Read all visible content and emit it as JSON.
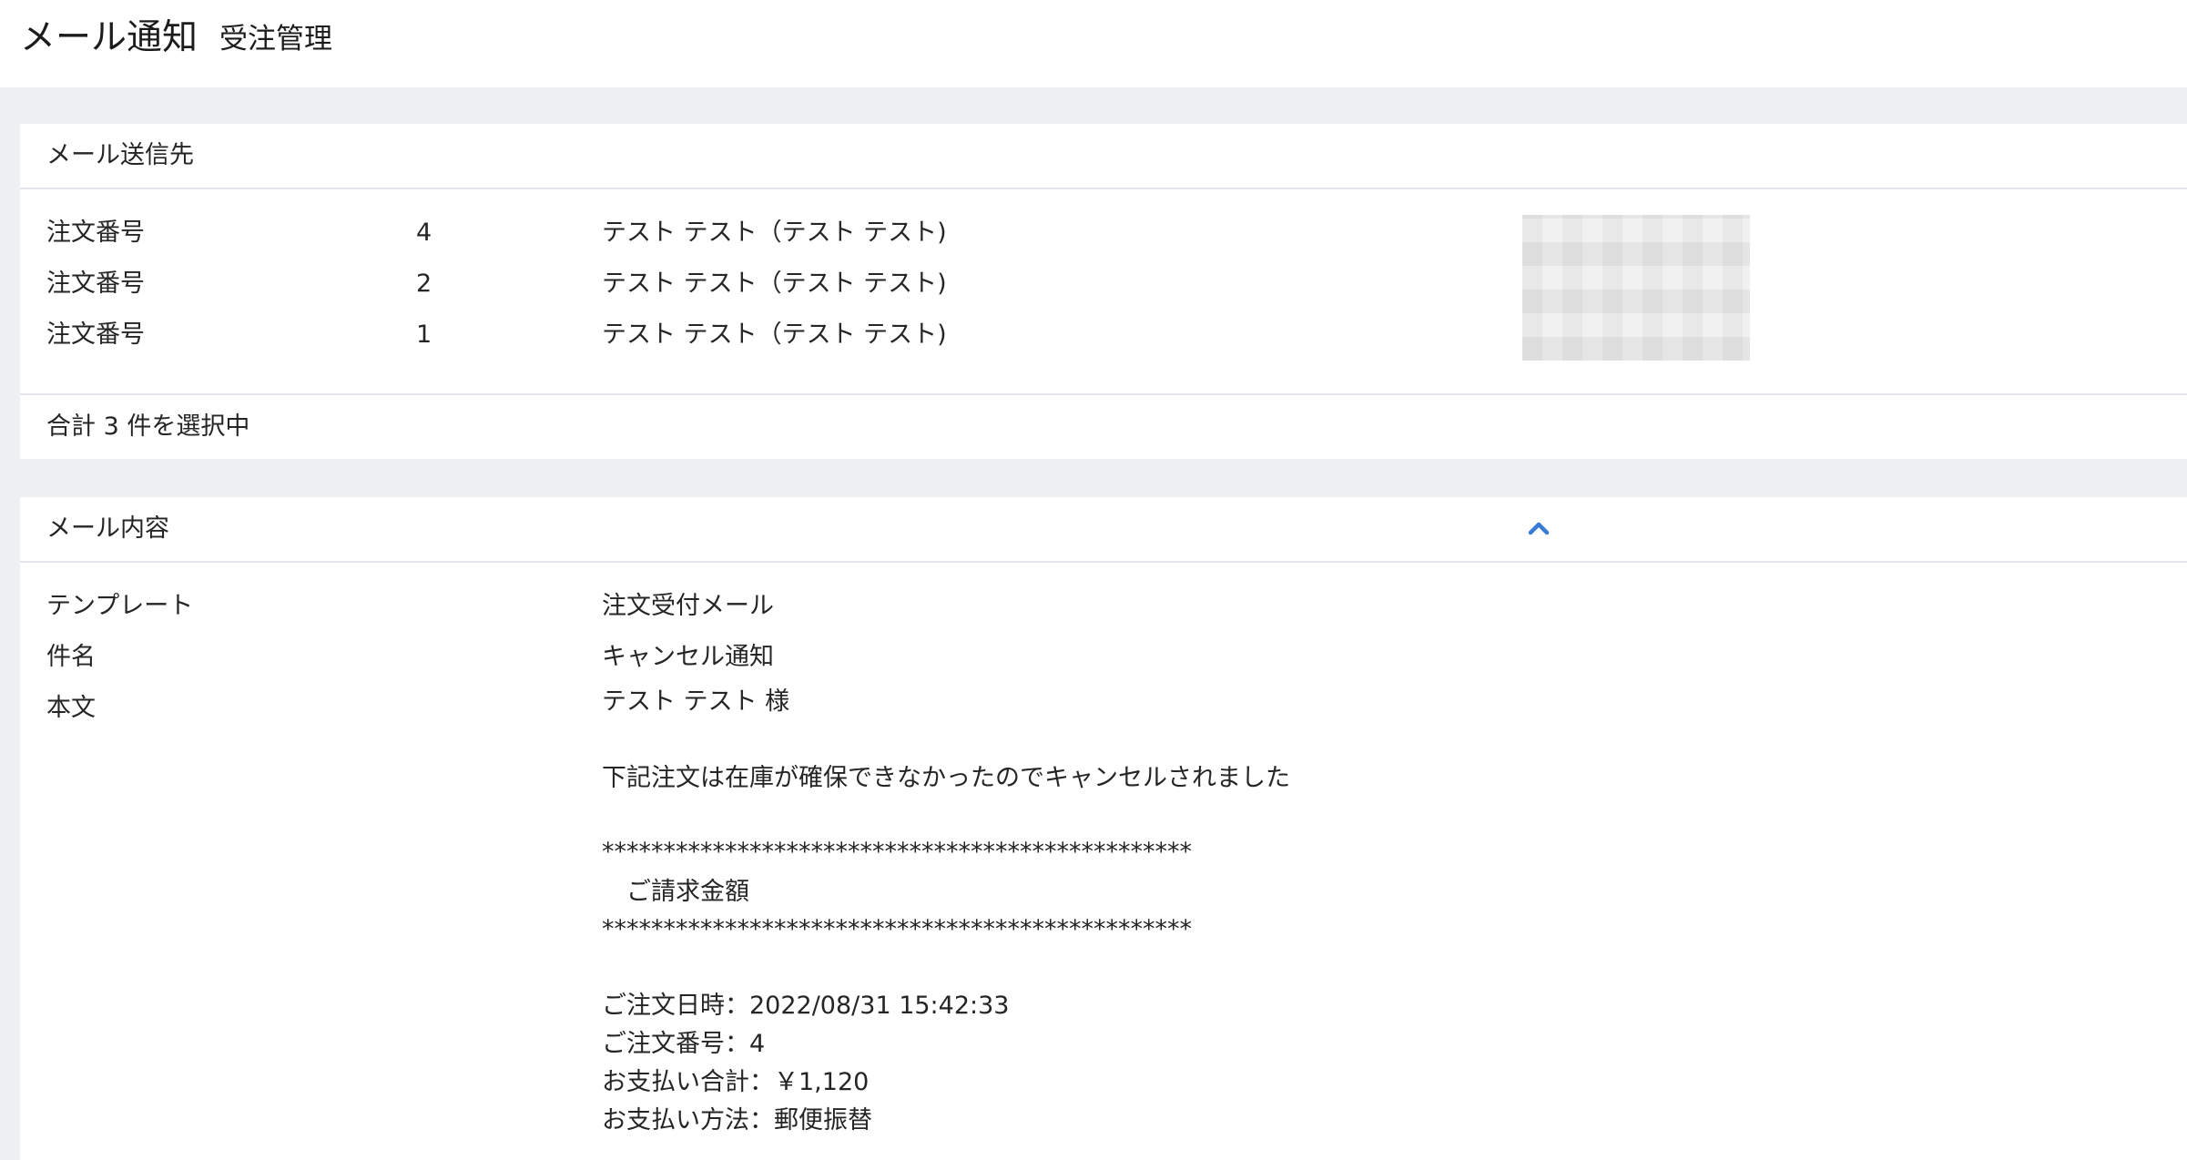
{
  "header": {
    "title": "メール通知",
    "subtitle": "受注管理"
  },
  "recipients": {
    "section_label": "メール送信先",
    "label": "注文番号",
    "rows": [
      {
        "label": "注文番号",
        "number": "4",
        "name": "テスト テスト（テスト テスト)"
      },
      {
        "label": "注文番号",
        "number": "2",
        "name": "テスト テスト（テスト テスト)"
      },
      {
        "label": "注文番号",
        "number": "1",
        "name": "テスト テスト（テスト テスト)"
      }
    ],
    "summary": "合計 3 件を選択中"
  },
  "mail_content": {
    "section_label": "メール内容",
    "toggle_icon": "chevron-up-icon",
    "accent_color": "#3a7bd5",
    "template_label": "テンプレート",
    "template_value": "注文受付メール",
    "subject_label": "件名",
    "subject_value": "キャンセル通知",
    "body_label": "本文",
    "body_lines": [
      "テスト テスト 様",
      "",
      "下記注文は在庫が確保できなかったのでキャンセルされました",
      "",
      "************************************************",
      "　ご請求金額",
      "************************************************",
      "",
      "ご注文日時：2022/08/31 15:42:33",
      "ご注文番号：4",
      "お支払い合計：￥1,120",
      "お支払い方法：郵便振替"
    ]
  }
}
